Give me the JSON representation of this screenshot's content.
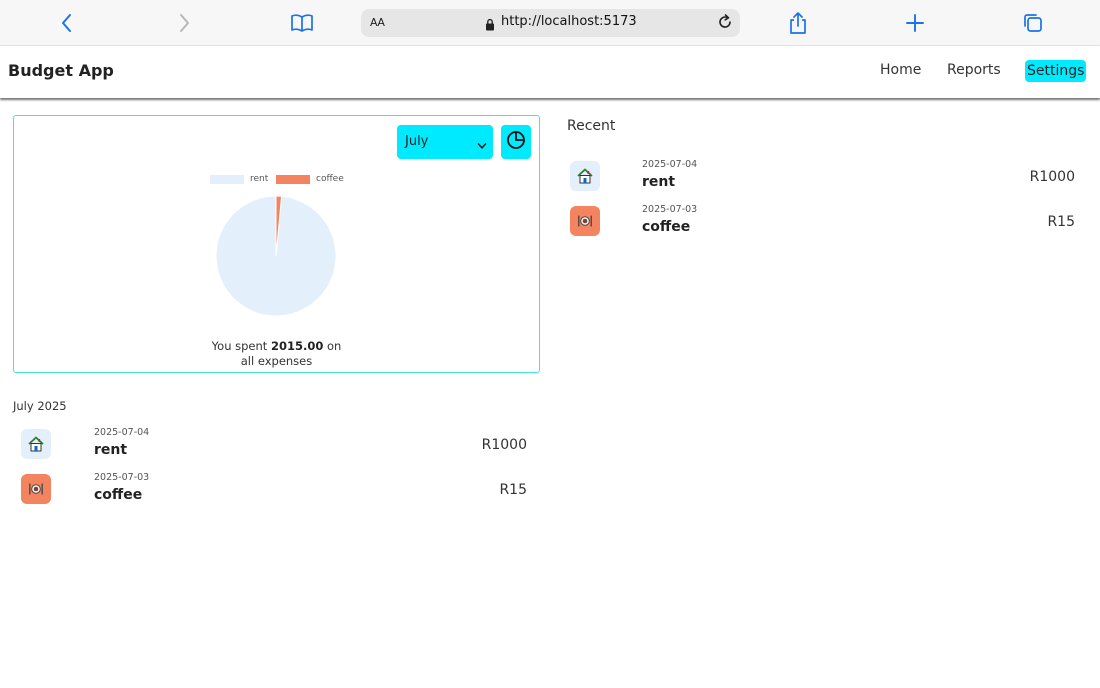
{
  "browser": {
    "text_size_label": "AA",
    "url": "http://localhost:5173"
  },
  "app": {
    "title": "Budget App",
    "nav": {
      "home": "Home",
      "reports": "Reports",
      "settings": "Settings"
    }
  },
  "summary": {
    "selected_month": "July",
    "spent_prefix": "You spent",
    "spent_amount": "2015.00",
    "spent_suffix": "on",
    "spent_suffix_line2": "all expenses"
  },
  "chart_data": {
    "type": "pie",
    "categories": [
      "rent",
      "coffee"
    ],
    "values": [
      1000,
      15
    ],
    "colors": [
      "#e3f0fb",
      "#f4845f"
    ],
    "legend": "top"
  },
  "colors": {
    "accent": "#00eaff",
    "card_border": "#3fe4f0",
    "rent": "#e3f0fb",
    "coffee": "#f4845f"
  },
  "recent": {
    "heading": "Recent",
    "items": [
      {
        "date": "2025-07-04",
        "name": "rent",
        "amount": "R1000",
        "icon": "house-icon"
      },
      {
        "date": "2025-07-03",
        "name": "coffee",
        "amount": "R15",
        "icon": "plate-icon"
      }
    ]
  },
  "month_list": {
    "heading": "July 2025",
    "items": [
      {
        "date": "2025-07-04",
        "name": "rent",
        "amount": "R1000",
        "icon": "house-icon"
      },
      {
        "date": "2025-07-03",
        "name": "coffee",
        "amount": "R15",
        "icon": "plate-icon"
      }
    ]
  }
}
